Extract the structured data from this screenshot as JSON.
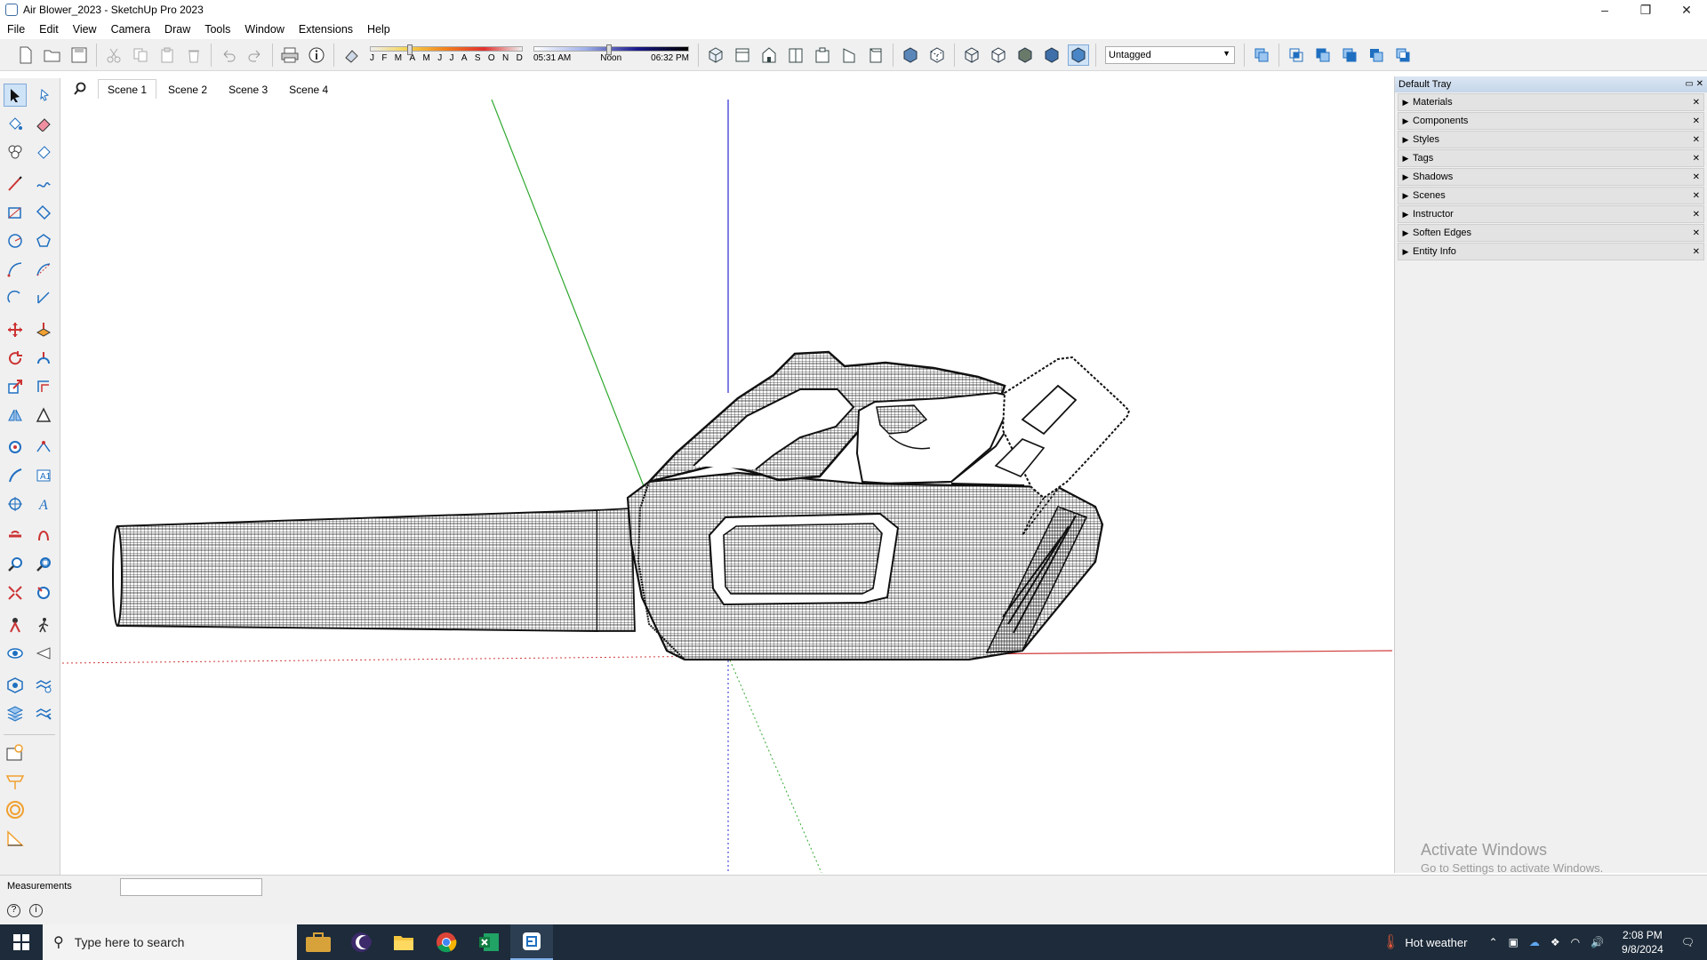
{
  "window": {
    "title": "Air Blower_2023 - SketchUp Pro 2023",
    "minimize": "–",
    "maximize": "❐",
    "close": "✕"
  },
  "menu": [
    "File",
    "Edit",
    "View",
    "Camera",
    "Draw",
    "Tools",
    "Window",
    "Extensions",
    "Help"
  ],
  "shadow": {
    "months": [
      "J",
      "F",
      "M",
      "A",
      "M",
      "J",
      "J",
      "A",
      "S",
      "O",
      "N",
      "D"
    ],
    "time_start": "05:31 AM",
    "time_mid": "Noon",
    "time_end": "06:32 PM",
    "date_position_fraction": 0.24,
    "time_position_fraction": 0.47
  },
  "tag_select": {
    "value": "Untagged"
  },
  "scenes": {
    "tabs": [
      "Scene 1",
      "Scene 2",
      "Scene 3",
      "Scene 4"
    ],
    "active": 0
  },
  "tray": {
    "title": "Default Tray",
    "panels": [
      "Materials",
      "Components",
      "Styles",
      "Tags",
      "Shadows",
      "Scenes",
      "Instructor",
      "Soften Edges",
      "Entity Info"
    ]
  },
  "status": {
    "measurements_label": "Measurements",
    "measurements_value": ""
  },
  "activation": {
    "line1": "Activate Windows",
    "line2": "Go to Settings to activate Windows."
  },
  "taskbar": {
    "search_placeholder": "Type here to search",
    "weather": "Hot weather",
    "time": "2:08 PM",
    "date": "9/8/2024"
  },
  "colors": {
    "axis_red": "#d03a3a",
    "axis_green": "#2fa82f",
    "axis_blue": "#2a2ad0",
    "accent": "#1f6fc0"
  }
}
